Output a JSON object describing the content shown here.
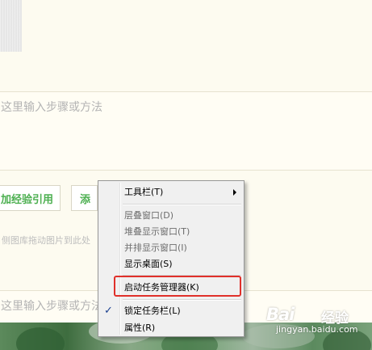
{
  "editor": {
    "step_placeholder_1": "这里输入步骤或方法",
    "step_placeholder_2": "这里输入步骤或方法",
    "add_experience_ref": "加经验引用",
    "add_button_partial": "添",
    "drag_hint": "侧图库拖动图片到此处"
  },
  "context_menu": {
    "toolbars": "工具栏(T)",
    "cascade": "层叠窗口(D)",
    "stacked": "堆叠显示窗口(T)",
    "side_by_side": "并排显示窗口(I)",
    "show_desktop": "显示桌面(S)",
    "task_manager": "启动任务管理器(K)",
    "lock_taskbar": "锁定任务栏(L)",
    "properties": "属性(R)",
    "check_mark": "✓"
  },
  "watermark": {
    "logo": "Bai",
    "name": "经验",
    "url": "jingyan.baidu.com"
  },
  "colors": {
    "highlight_border": "#e0302a",
    "button_text": "#4caf50",
    "page_background": "#fdfbf0"
  }
}
